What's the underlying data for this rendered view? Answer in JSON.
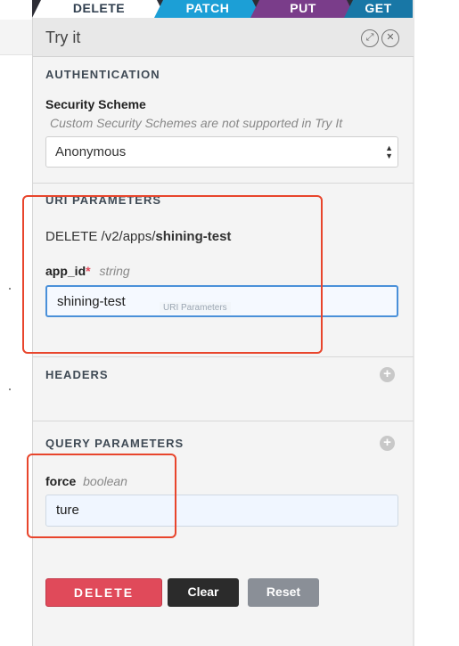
{
  "tabs": [
    "DELETE",
    "PATCH",
    "PUT",
    "GET"
  ],
  "panel": {
    "title": "Try it",
    "authentication": {
      "heading": "AUTHENTICATION",
      "scheme_label": "Security Scheme",
      "scheme_note": "Custom Security Schemes are not supported in Try It",
      "scheme_value": "Anonymous"
    },
    "uri_parameters": {
      "heading": "URI PARAMETERS",
      "method": "DELETE",
      "path_prefix": "/v2/apps/",
      "path_param": "shining-test",
      "param_name": "app_id",
      "required_mark": "*",
      "param_type": "string",
      "param_value": "shining-test",
      "tooltip": "URI Parameters"
    },
    "headers": {
      "heading": "HEADERS",
      "add_icon": "+"
    },
    "query_parameters": {
      "heading": "QUERY PARAMETERS",
      "add_icon": "+",
      "param_name": "force",
      "param_type": "boolean",
      "param_value": "ture"
    },
    "buttons": {
      "delete": "DELETE",
      "clear": "Clear",
      "reset": "Reset"
    }
  },
  "colors": {
    "patch": "#1c9fd6",
    "put": "#7a3d8a",
    "get": "#1877a6",
    "delete_button": "#e04a5a",
    "highlight": "#e8452c"
  }
}
